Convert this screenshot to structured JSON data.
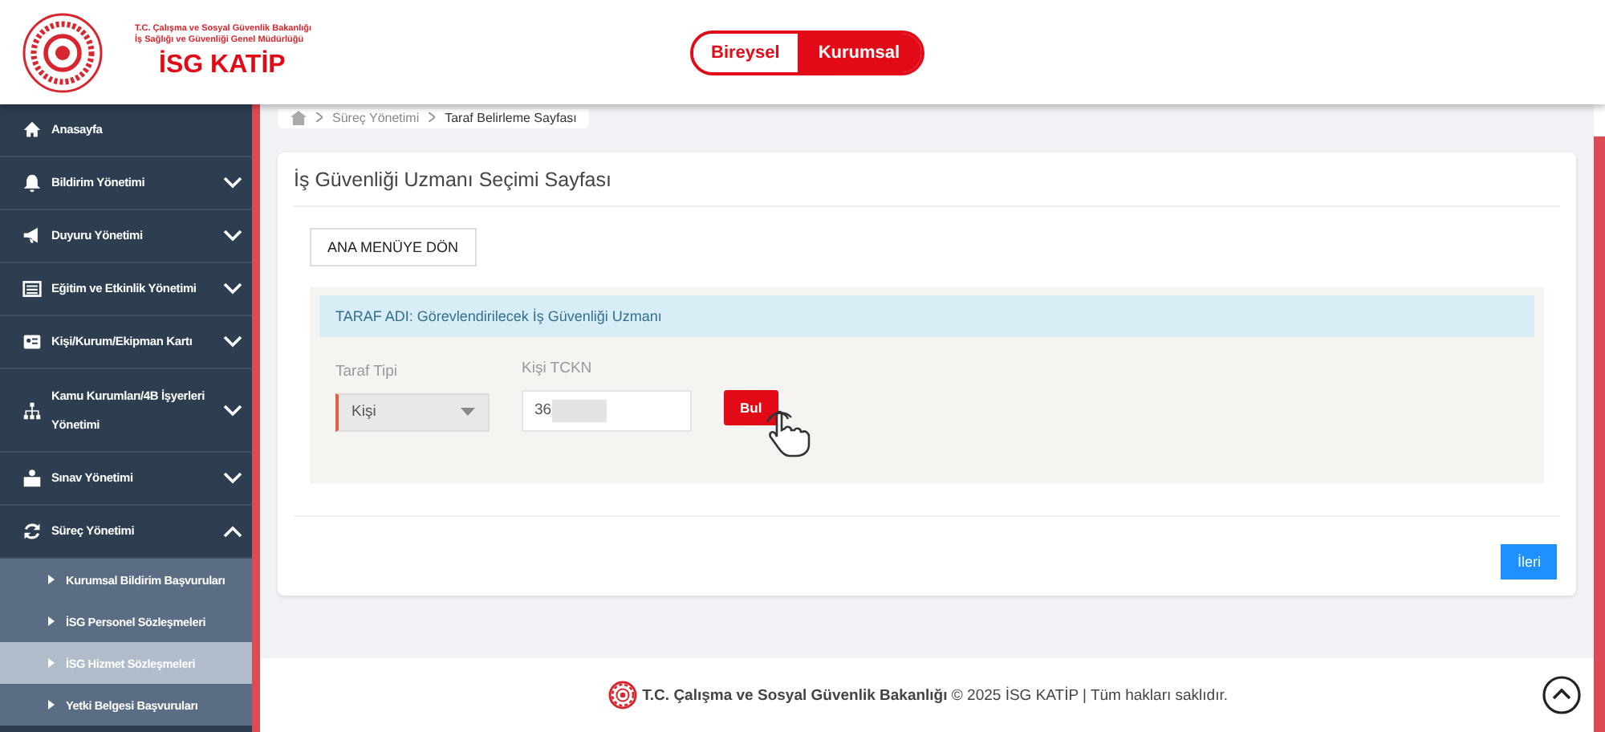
{
  "header": {
    "ministry_line_1": "T.C. Çalışma ve Sosyal Güvenlik Bakanlığı",
    "ministry_line_2": "İş Sağlığı ve Güvenliği Genel Müdürlüğü",
    "app_name": "İSG KATİP",
    "user_types": [
      {
        "label": "Bireysel",
        "selected": false
      },
      {
        "label": "Kurumsal",
        "selected": true
      }
    ]
  },
  "sidebar": {
    "items": [
      {
        "label": "Anasayfa"
      },
      {
        "label": "Bildirim Yönetimi",
        "expanded": false
      },
      {
        "label": "Duyuru Yönetimi",
        "expanded": false
      },
      {
        "label": "Eğitim ve Etkinlik Yönetimi",
        "expanded": false
      },
      {
        "label": "Kişi/Kurum/Ekipman Kartı",
        "expanded": false
      },
      {
        "label": "Kamu Kurumları/4B İşyerleri Yönetimi",
        "expanded": false
      },
      {
        "label": "Sınav Yönetimi",
        "expanded": false
      },
      {
        "label": "Süreç Yönetimi",
        "expanded": true,
        "children": [
          {
            "label": "Kurumsal Bildirim Başvuruları",
            "selected": false
          },
          {
            "label": "İSG Personel Sözleşmeleri",
            "selected": false
          },
          {
            "label": "İSG Hizmet Sözleşmeleri",
            "selected": true
          },
          {
            "label": "Yetki Belgesi Başvuruları",
            "selected": false
          }
        ]
      }
    ]
  },
  "breadcrumb": [
    "Süreç Yönetimi",
    "Taraf Belirleme Sayfası"
  ],
  "page": {
    "title": "İş Güvenliği Uzmanı Seçimi Sayfası",
    "back_button": "ANA MENÜYE DÖN",
    "party_heading": "TARAF ADI: Görevlendirilecek İş Güvenliği Uzmanı",
    "party_type": {
      "label": "Taraf Tipi",
      "value": "Kişi"
    },
    "tckn": {
      "label": "Kişi TCKN",
      "value": "36"
    },
    "find_button": "Bul",
    "next_button": "İleri"
  },
  "footer": {
    "ministry": "T.C. Çalışma ve Sosyal Güvenlik Bakanlığı",
    "rest": "© 2025 İSG KATİP | Tüm hakları saklıdır."
  }
}
